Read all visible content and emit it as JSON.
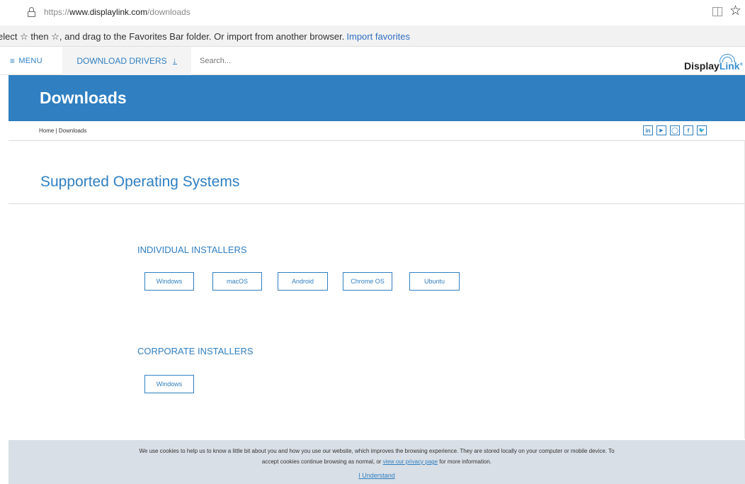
{
  "browser": {
    "url_scheme": "https://",
    "url_host": "www.displaylink.com",
    "url_path": "/downloads",
    "favorites_message": "elect ☆ then ☆, and drag to the Favorites Bar folder. Or import from another browser.",
    "import_favorites_label": "Import favorites"
  },
  "nav": {
    "menu_label": "MENU",
    "menu_icon": "≡",
    "download_drivers_label": "DOWNLOAD DRIVERS",
    "download_arrow": "↓",
    "search_placeholder": "Search...",
    "logo_text_display": "Display",
    "logo_text_link": "Link",
    "logo_mark": "®"
  },
  "banner": {
    "title": "Downloads"
  },
  "breadcrumb": {
    "text": "Home | Downloads"
  },
  "social": {
    "linkedin": "in",
    "youtube": "▶",
    "refresh": "◯",
    "facebook": "f",
    "twitter": "🐦"
  },
  "main": {
    "section_title": "Supported Operating Systems",
    "individual_title": "INDIVIDUAL INSTALLERS",
    "individual_buttons": [
      "Windows",
      "macOS",
      "Android",
      "Chrome OS",
      "Ubuntu"
    ],
    "corporate_title": "CORPORATE INSTALLERS",
    "corporate_buttons": [
      "Windows"
    ]
  },
  "cookie": {
    "line1": "We use cookies to help us to know a little bit about you and how you use our website, which improves the browsing experience. They are stored locally on your computer or mobile device. To",
    "line2_prefix": "accept cookies continue browsing as normal, or",
    "line2_link": "view our privacy page",
    "line2_suffix": "for more information.",
    "accept_label": "I Understand"
  },
  "colors": {
    "accent": "#2f7fc1",
    "cookie_bg": "#d9dfe6"
  }
}
